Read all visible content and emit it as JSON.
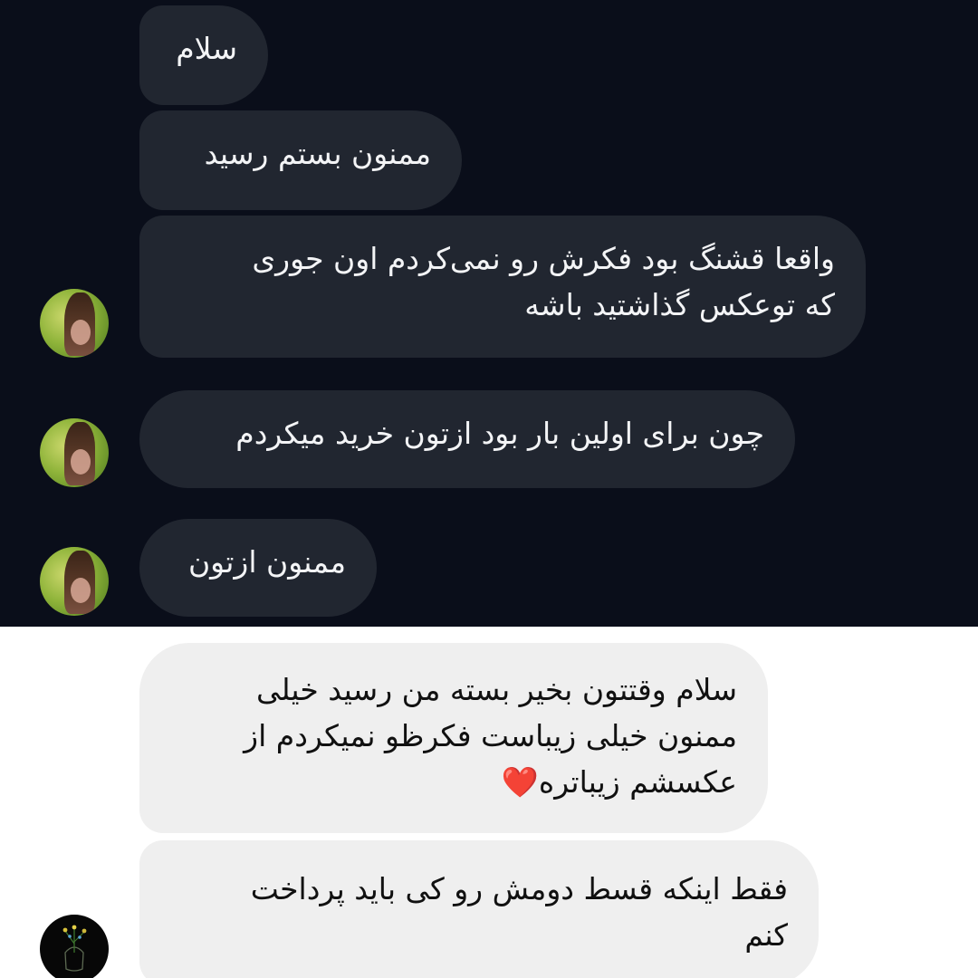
{
  "conversation_top": {
    "messages": [
      {
        "text": "سلام"
      },
      {
        "text": "ممنون بستم رسید"
      },
      {
        "lines": [
          "واقعا قشنگ بود فکرش رو نمی‌کردم اون جوری",
          "که توعکس گذاشتید باشه"
        ]
      },
      {
        "text": "چون برای اولین بار بود ازتون خرید میکردم"
      },
      {
        "text": "ممنون ازتون"
      }
    ],
    "avatar_icon": "user-avatar-icon"
  },
  "conversation_bottom": {
    "messages": [
      {
        "lines": [
          "سلام وقتتون بخیر بسته من رسید خیلی",
          "ممنون خیلی زیباست فکرظو نمیکردم از",
          "عکسشم زیباتره❤️"
        ]
      },
      {
        "lines": [
          "فقط اینکه قسط دومش رو کی باید پرداخت",
          "کنم"
        ]
      }
    ],
    "avatar_icon": "flower-jar-avatar-icon"
  },
  "colors": {
    "dark_background": "#0a0e1a",
    "dark_bubble": "#212630",
    "light_background": "#ffffff",
    "light_bubble": "#efefef",
    "heart": "#e0141b"
  }
}
